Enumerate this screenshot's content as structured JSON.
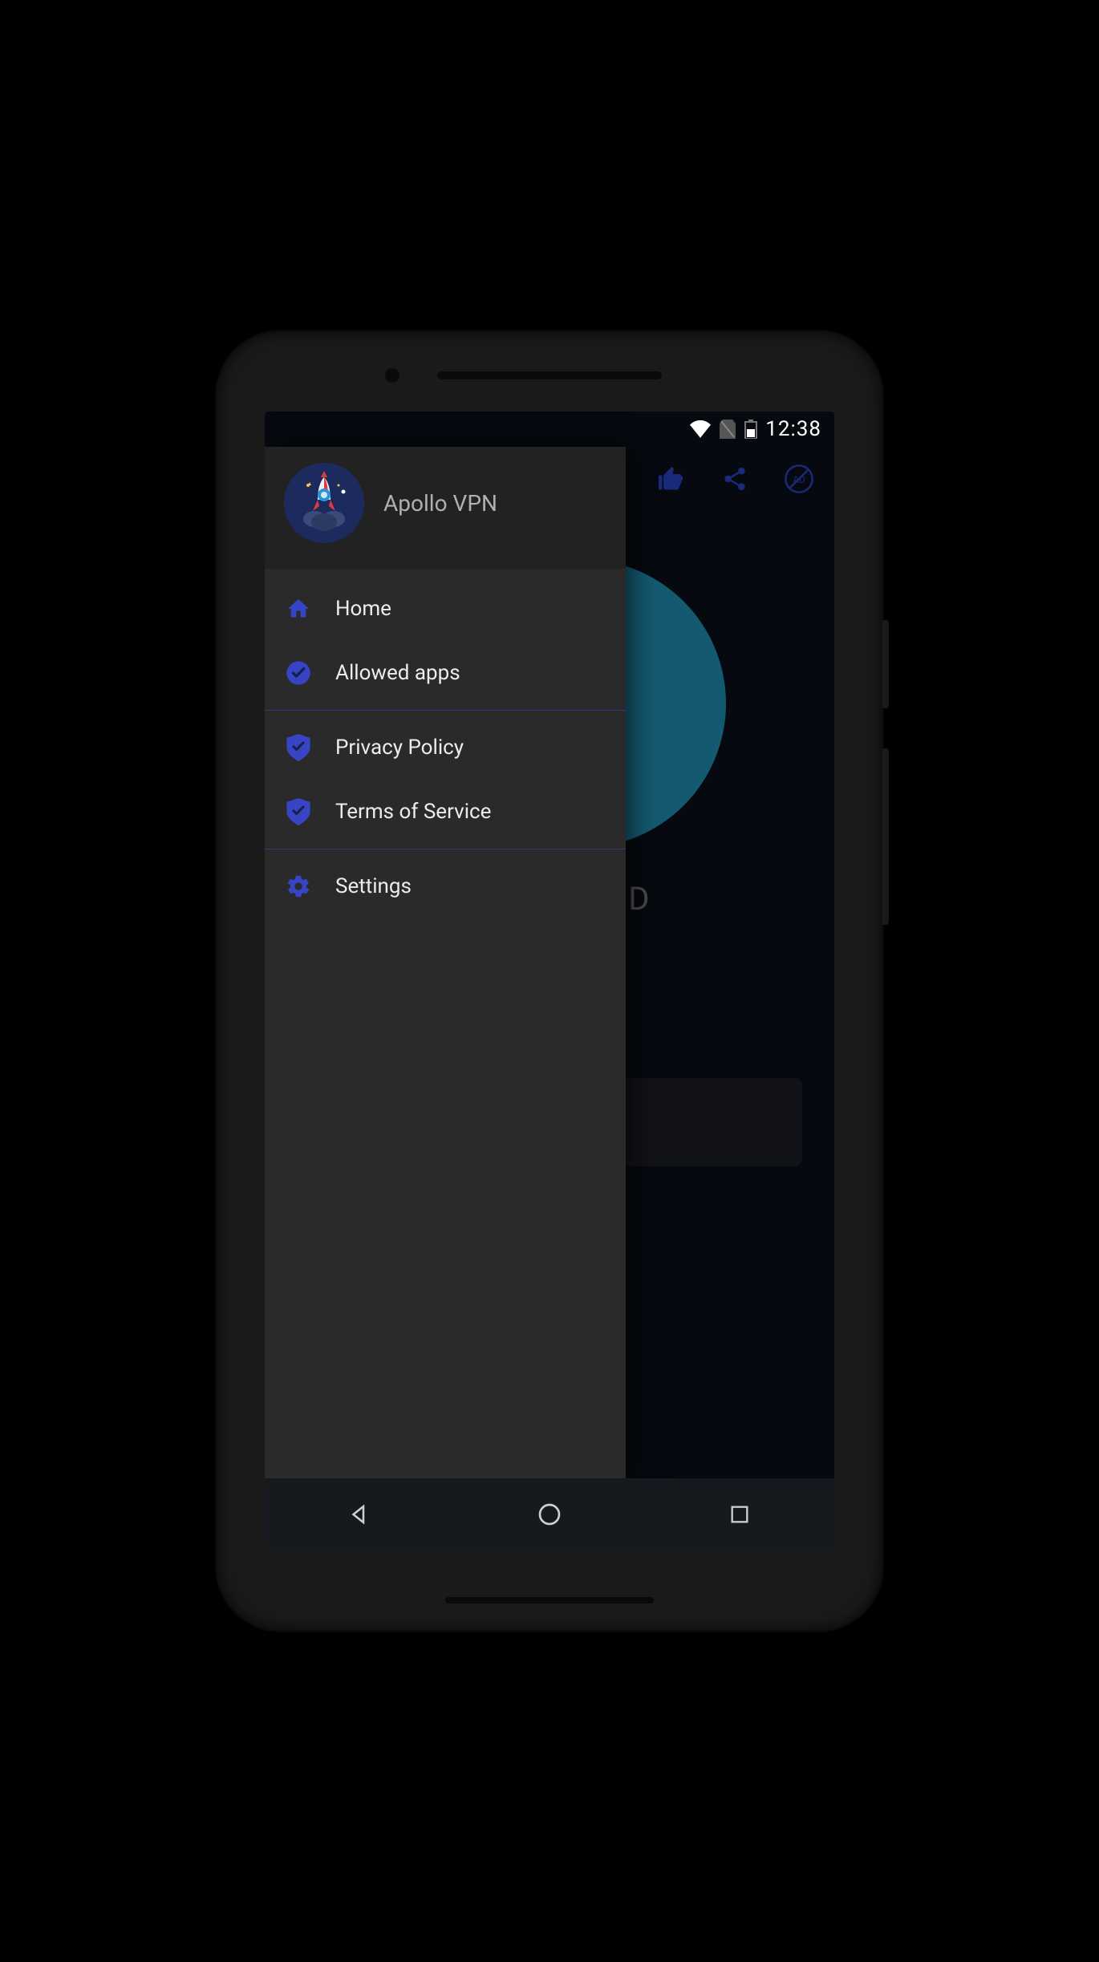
{
  "status_bar": {
    "time": "12:38"
  },
  "app": {
    "title": "Apollo VPN",
    "connection_status": "ED"
  },
  "drawer": {
    "items": [
      {
        "label": "Home",
        "icon": "home"
      },
      {
        "label": "Allowed apps",
        "icon": "check-circle"
      },
      {
        "label": "Privacy Policy",
        "icon": "shield-check"
      },
      {
        "label": "Terms of Service",
        "icon": "shield-check"
      },
      {
        "label": "Settings",
        "icon": "gear"
      }
    ]
  },
  "colors": {
    "accent": "#3744c5",
    "accent_light": "#4a57d8"
  }
}
